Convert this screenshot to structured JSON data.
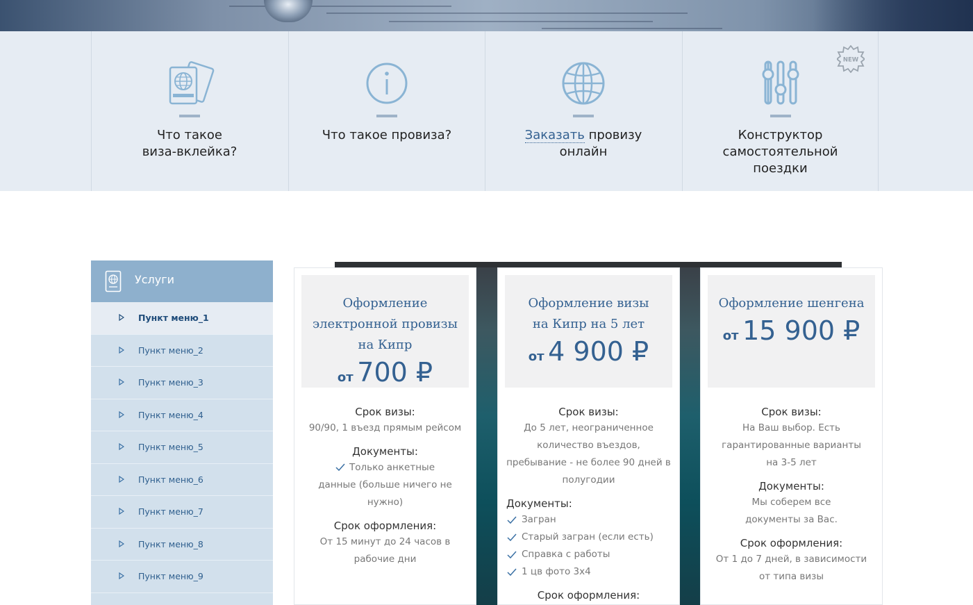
{
  "features": [
    {
      "icon": "passport-icon",
      "title_line1": "Что такое",
      "title_line2": "виза-вклейка?"
    },
    {
      "icon": "info-icon",
      "title_line1": "Что такое провиза?"
    },
    {
      "icon": "globe-icon",
      "title_link": "Заказать",
      "title_rest": " провизу",
      "title_line2": "онлайн"
    },
    {
      "icon": "sliders-icon",
      "title_line1": "Конструктор",
      "title_line2": "самостоятельной",
      "title_line3": "поездки",
      "badge": "NEW"
    }
  ],
  "sidebar": {
    "title": "Услуги",
    "items": [
      {
        "label": "Пункт меню_1",
        "active": true
      },
      {
        "label": "Пункт меню_2"
      },
      {
        "label": "Пункт меню_3"
      },
      {
        "label": "Пункт меню_4"
      },
      {
        "label": "Пункт меню_5"
      },
      {
        "label": "Пункт меню_6"
      },
      {
        "label": "Пункт меню_7"
      },
      {
        "label": "Пункт меню_8"
      },
      {
        "label": "Пункт меню_9"
      }
    ]
  },
  "cards": [
    {
      "title": "Оформление электронной провизы на Кипр",
      "price_from": "от",
      "price": "700 ₽",
      "term_label": "Срок визы:",
      "term_value": "90/90, 1 въезд прямым рейсом",
      "docs_label": "Документы:",
      "docs": [
        "Только анкетные данные (больше ничего не нужно)"
      ],
      "processing_label": "Срок оформления:",
      "processing_value": "От 15 минут до 24 часов в рабочие дни"
    },
    {
      "title": "Оформление визы на Кипр на 5 лет",
      "price_from": "от",
      "price": "4 900 ₽",
      "term_label": "Срок визы:",
      "term_value": "До 5 лет, неограниченное количество въездов, пребывание - не более 90 дней в полугодии",
      "docs_label": "Документы:",
      "docs": [
        "Загран",
        "Старый загран (если есть)",
        "Справка с работы",
        "1 цв фото 3х4"
      ],
      "processing_label": "Срок оформления:"
    },
    {
      "title": "Оформление шенгена",
      "price_from": "от",
      "price": "15 900 ₽",
      "term_label": "Срок визы:",
      "term_value": "На Ваш выбор. Есть гарантированные варианты на 3-5 лет",
      "docs_label": "Документы:",
      "docs_value": "Мы соберем все документы за Вас.",
      "processing_label": "Срок оформления:",
      "processing_value": "От 1 до 7 дней, в зависимости от типа визы"
    }
  ],
  "colors": {
    "accent": "#346191",
    "strip_bg": "#e6ecf3",
    "sidebar_head": "#8eb0cd",
    "sidebar_bg": "#d2e0ec"
  }
}
